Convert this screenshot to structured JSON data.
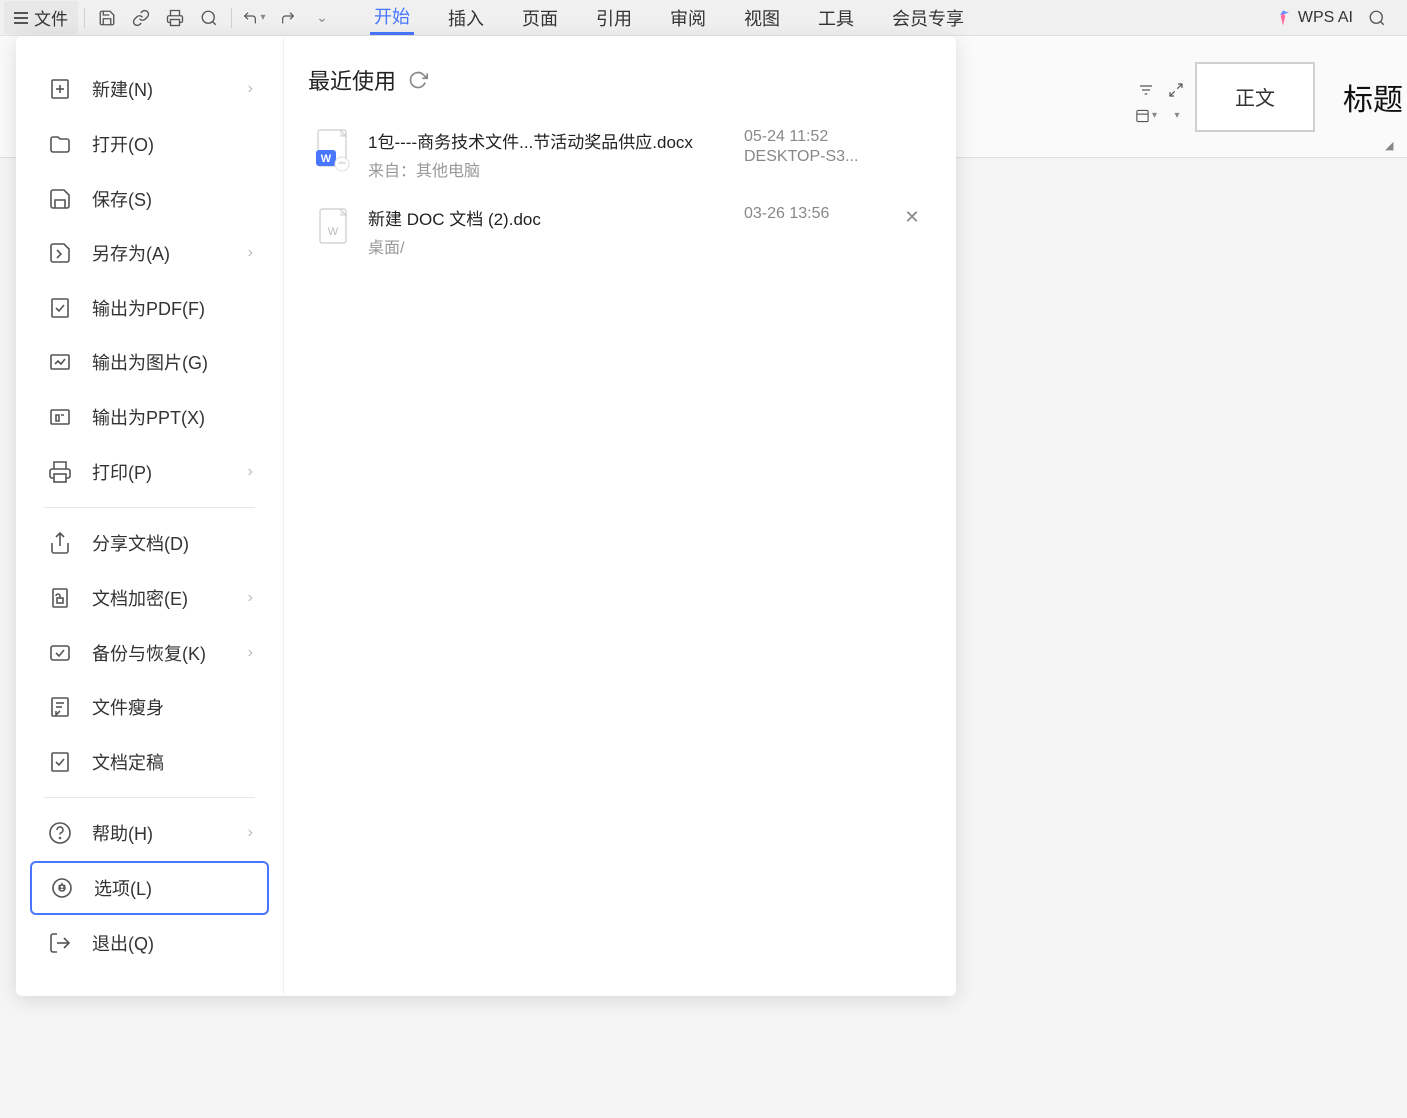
{
  "toolbar": {
    "file_label": "文件"
  },
  "ribbon": {
    "tabs": [
      {
        "label": "开始",
        "active": true
      },
      {
        "label": "插入"
      },
      {
        "label": "页面"
      },
      {
        "label": "引用"
      },
      {
        "label": "审阅"
      },
      {
        "label": "视图"
      },
      {
        "label": "工具"
      },
      {
        "label": "会员专享"
      }
    ],
    "wps_ai_label": "WPS AI",
    "style_box_label": "正文",
    "style_heading_label": "标题"
  },
  "sidebar": {
    "items": [
      {
        "label": "新建(N)",
        "chevron": true
      },
      {
        "label": "打开(O)"
      },
      {
        "label": "保存(S)"
      },
      {
        "label": "另存为(A)",
        "chevron": true
      },
      {
        "label": "输出为PDF(F)"
      },
      {
        "label": "输出为图片(G)"
      },
      {
        "label": "输出为PPT(X)"
      },
      {
        "label": "打印(P)",
        "chevron": true,
        "divider_after": true
      },
      {
        "label": "分享文档(D)"
      },
      {
        "label": "文档加密(E)",
        "chevron": true
      },
      {
        "label": "备份与恢复(K)",
        "chevron": true
      },
      {
        "label": "文件瘦身"
      },
      {
        "label": "文档定稿",
        "divider_after": true
      },
      {
        "label": "帮助(H)",
        "chevron": true
      },
      {
        "label": "选项(L)",
        "selected": true
      },
      {
        "label": "退出(Q)"
      }
    ]
  },
  "recent": {
    "title": "最近使用",
    "source_prefix": "来自：",
    "files": [
      {
        "name": "1包----商务技术文件...节活动奖品供应.docx",
        "source": "其他电脑",
        "time": "05-24 11:52",
        "device": "DESKTOP-S3...",
        "type": "docx-cloud",
        "show_close": false
      },
      {
        "name": "新建 DOC 文档 (2).doc",
        "source_path": "桌面/",
        "time": "03-26 13:56",
        "type": "doc",
        "show_close": true
      }
    ]
  }
}
